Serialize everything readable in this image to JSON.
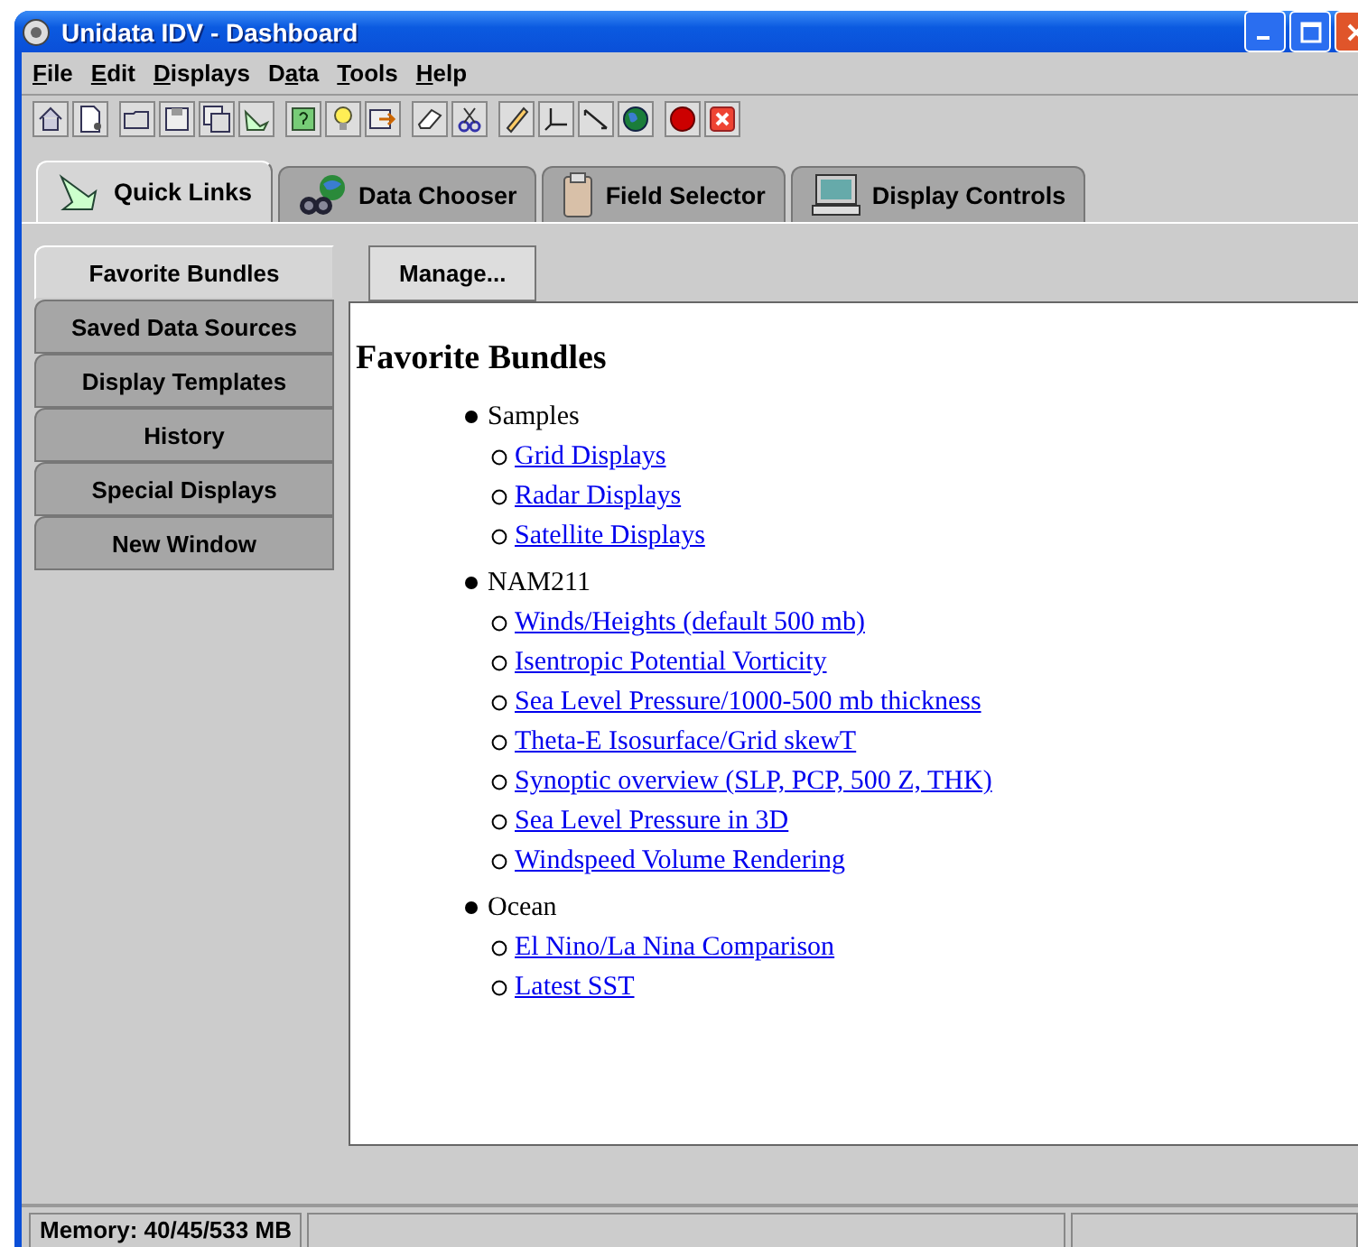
{
  "window": {
    "title": "Unidata IDV - Dashboard"
  },
  "menu": [
    {
      "label": "File"
    },
    {
      "label": "Edit"
    },
    {
      "label": "Displays"
    },
    {
      "label": "Data"
    },
    {
      "label": "Tools"
    },
    {
      "label": "Help"
    }
  ],
  "tabs": [
    {
      "label": "Quick Links",
      "selected": true,
      "kind": "links"
    },
    {
      "label": "Data Chooser",
      "selected": false,
      "kind": "chooser"
    },
    {
      "label": "Field Selector",
      "selected": false,
      "kind": "clipboard"
    },
    {
      "label": "Display Controls",
      "selected": false,
      "kind": "monitor"
    }
  ],
  "side_tabs": [
    {
      "label": "Favorite Bundles",
      "selected": true
    },
    {
      "label": "Saved Data Sources",
      "selected": false
    },
    {
      "label": "Display Templates",
      "selected": false
    },
    {
      "label": "History",
      "selected": false
    },
    {
      "label": "Special Displays",
      "selected": false
    },
    {
      "label": "New Window",
      "selected": false
    }
  ],
  "manage_button": "Manage...",
  "heading": "Favorite Bundles",
  "groups": [
    {
      "name": "Samples",
      "links": [
        "Grid Displays",
        "Radar Displays",
        "Satellite Displays"
      ]
    },
    {
      "name": "NAM211",
      "links": [
        "Winds/Heights (default 500 mb)",
        "Isentropic Potential Vorticity",
        "Sea Level Pressure/1000-500 mb thickness",
        "Theta-E Isosurface/Grid skewT",
        "Synoptic overview (SLP, PCP, 500 Z, THK)",
        "Sea Level Pressure in 3D",
        "Windspeed Volume Rendering"
      ]
    },
    {
      "name": "Ocean",
      "links": [
        "El Nino/La Nina Comparison",
        "Latest SST"
      ]
    }
  ],
  "status_bar": {
    "memory": "Memory: 40/45/533 MB"
  }
}
